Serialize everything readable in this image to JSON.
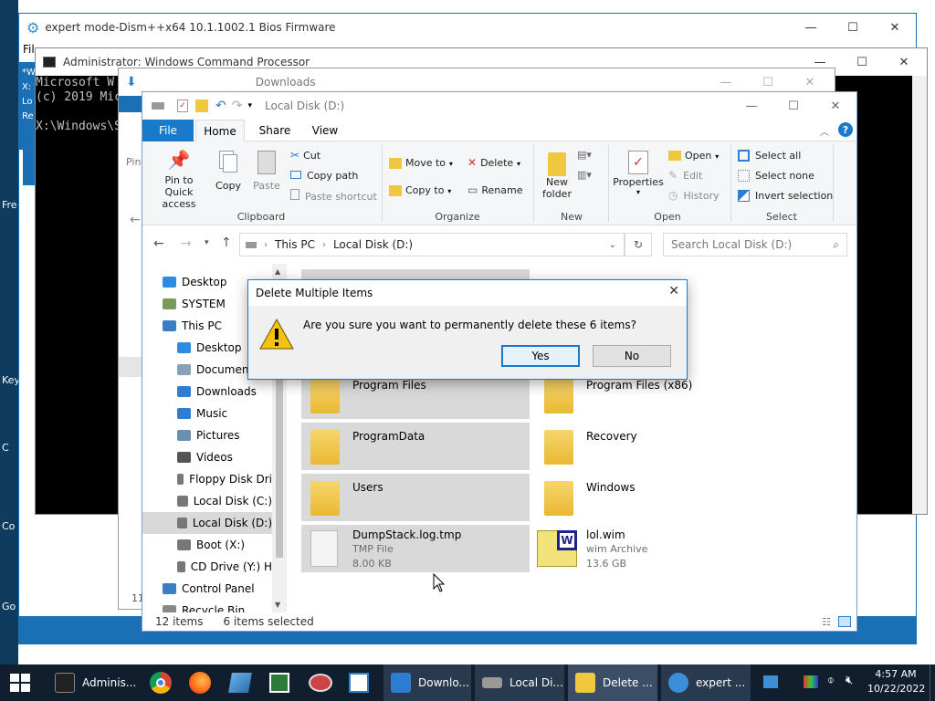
{
  "desktop_labels": [
    "Fre",
    "Key",
    "C",
    "Co",
    "Go"
  ],
  "dism": {
    "title": "expert mode-Dism++x64 10.1.1002.1 Bios Firmware",
    "menu_partial": "Fil"
  },
  "cmd": {
    "title": "Administrator: Windows Command Processor",
    "lines": [
      "Microsoft W",
      "(c) 2019 Mic",
      "",
      "X:\\Windows\\S"
    ],
    "side": [
      "*W",
      "X:",
      "Lo",
      "Re"
    ]
  },
  "downloads": {
    "title": "Downloads",
    "partial_label": "Pin",
    "status_partial": "11"
  },
  "explorer": {
    "title": "Local Disk (D:)",
    "tabs": [
      "File",
      "Home",
      "Share",
      "View"
    ],
    "ribbon": {
      "clipboard": {
        "pin": "Pin to Quick access",
        "copy": "Copy",
        "paste": "Paste",
        "cut": "Cut",
        "copy_path": "Copy path",
        "paste_shortcut": "Paste shortcut",
        "label": "Clipboard"
      },
      "organize": {
        "move_to": "Move to",
        "copy_to": "Copy to",
        "delete": "Delete",
        "rename": "Rename",
        "label": "Organize"
      },
      "new": {
        "new_folder": "New folder",
        "label": "New"
      },
      "open": {
        "properties": "Properties",
        "open": "Open",
        "edit": "Edit",
        "history": "History",
        "label": "Open"
      },
      "select": {
        "select_all": "Select all",
        "select_none": "Select none",
        "invert": "Invert selection",
        "label": "Select"
      }
    },
    "address": {
      "crumbs": [
        "This PC",
        "Local Disk (D:)"
      ],
      "search_placeholder": "Search Local Disk (D:)"
    },
    "nav": [
      {
        "label": "Desktop",
        "indent": 0,
        "color": "#2e8ce0"
      },
      {
        "label": "SYSTEM",
        "indent": 0,
        "color": "#7a9a5a"
      },
      {
        "label": "This PC",
        "indent": 0,
        "color": "#3a7fc4"
      },
      {
        "label": "Desktop",
        "indent": 1,
        "color": "#2e8ce0"
      },
      {
        "label": "Documents",
        "indent": 1,
        "color": "#8aa0b8"
      },
      {
        "label": "Downloads",
        "indent": 1,
        "color": "#2d7dd2"
      },
      {
        "label": "Music",
        "indent": 1,
        "color": "#2d7dd2"
      },
      {
        "label": "Pictures",
        "indent": 1,
        "color": "#6a8fb0"
      },
      {
        "label": "Videos",
        "indent": 1,
        "color": "#555"
      },
      {
        "label": "Floppy Disk Dri",
        "indent": 1,
        "color": "#777"
      },
      {
        "label": "Local Disk (C:)",
        "indent": 1,
        "color": "#777"
      },
      {
        "label": "Local Disk (D:)",
        "indent": 1,
        "color": "#777"
      },
      {
        "label": "Boot (X:)",
        "indent": 1,
        "color": "#777"
      },
      {
        "label": "CD Drive (Y:) H",
        "indent": 1,
        "color": "#777"
      },
      {
        "label": "Control Panel",
        "indent": 0,
        "color": "#3a7fc4"
      },
      {
        "label": "Recycle Bin",
        "indent": 0,
        "color": "#888"
      }
    ],
    "items": [
      {
        "name": "Program Files",
        "type": "",
        "size": "",
        "kind": "folder",
        "selected": true
      },
      {
        "name": "Program Files (x86)",
        "type": "",
        "size": "",
        "kind": "folder",
        "selected": false
      },
      {
        "name": "ProgramData",
        "type": "",
        "size": "",
        "kind": "folder",
        "selected": true
      },
      {
        "name": "Recovery",
        "type": "",
        "size": "",
        "kind": "folder",
        "selected": false
      },
      {
        "name": "Users",
        "type": "",
        "size": "",
        "kind": "folder",
        "selected": true
      },
      {
        "name": "Windows",
        "type": "",
        "size": "",
        "kind": "folder",
        "selected": false
      },
      {
        "name": "DumpStack.log.tmp",
        "type": "TMP File",
        "size": "8.00 KB",
        "kind": "file",
        "selected": true
      },
      {
        "name": "lol.wim",
        "type": "wim Archive",
        "size": "13.6 GB",
        "kind": "wim",
        "selected": false
      }
    ],
    "status": {
      "count": "12 items",
      "selected": "6 items selected"
    }
  },
  "dialog": {
    "title": "Delete Multiple Items",
    "message": "Are you sure you want to permanently delete these 6 items?",
    "yes": "Yes",
    "no": "No"
  },
  "taskbar": {
    "buttons": [
      {
        "label": "Adminis...",
        "icon": "cmd-icon",
        "color": "#222"
      },
      {
        "label": "Downlo...",
        "icon": "downloads-icon",
        "color": "#2d7dd2"
      },
      {
        "label": "Local Di...",
        "icon": "drive-icon",
        "color": "#999"
      },
      {
        "label": "Delete ...",
        "icon": "folder-icon",
        "color": "#f0c840"
      },
      {
        "label": "expert ...",
        "icon": "gear-icon",
        "color": "#3a8fd6"
      }
    ],
    "time": "4:57 AM",
    "date": "10/22/2022"
  }
}
